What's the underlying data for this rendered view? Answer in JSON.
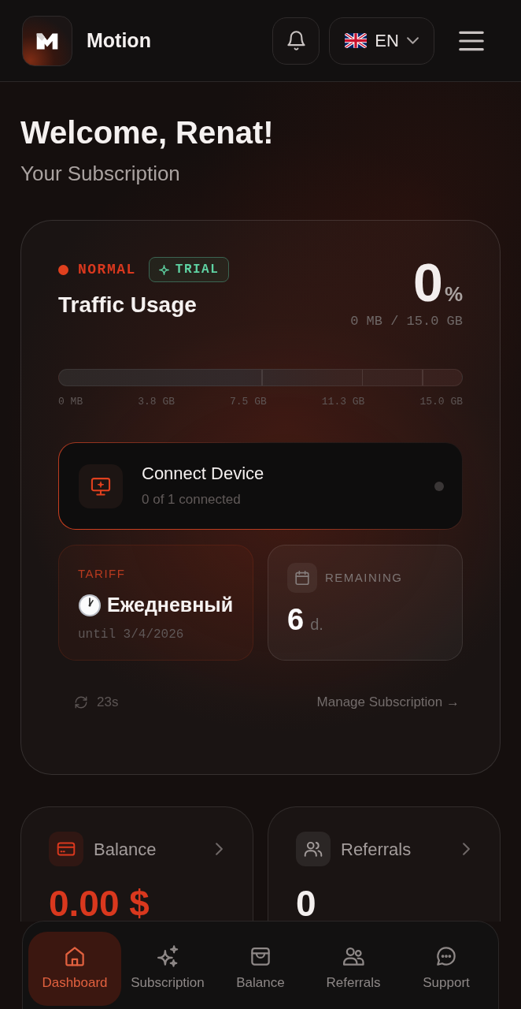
{
  "header": {
    "brand": "Motion",
    "language": "EN"
  },
  "greeting": {
    "title": "Welcome, Renat!",
    "subtitle": "Your Subscription"
  },
  "subscription": {
    "status": "NORMAL",
    "badge": "TRIAL",
    "title": "Traffic Usage",
    "percent": "0",
    "percent_unit": "%",
    "usage": "0 MB / 15.0 GB",
    "traffic": {
      "level": 0,
      "ticks": [
        "0 MB",
        "3.8 GB",
        "7.5 GB",
        "11.3 GB",
        "15.0 GB"
      ]
    },
    "device": {
      "title": "Connect Device",
      "subtitle": "0 of 1 connected",
      "online": false
    },
    "tariff": {
      "label": "TARIFF",
      "name": "Ежедневный",
      "until": "until 3/4/2026"
    },
    "remaining": {
      "label": "REMAINING",
      "value": "6",
      "unit": "d."
    },
    "refresh": "23s",
    "manage_link": "Manage Subscription →"
  },
  "stats": [
    {
      "kind": "balance",
      "label": "Balance",
      "value": "0.00 $"
    },
    {
      "kind": "referrals",
      "label": "Referrals",
      "value": "0"
    }
  ],
  "bottom_nav": [
    {
      "label": "Dashboard",
      "selected": true
    },
    {
      "label": "Subscription",
      "selected": false
    },
    {
      "label": "Balance",
      "selected": false
    },
    {
      "label": "Referrals",
      "selected": false
    },
    {
      "label": "Support",
      "selected": false
    }
  ]
}
